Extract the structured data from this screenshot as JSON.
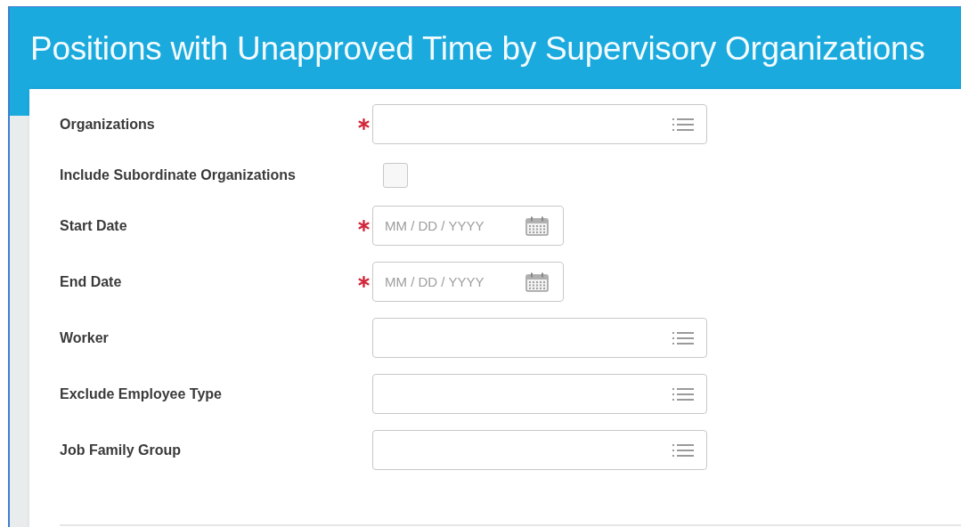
{
  "page": {
    "title": "Positions with Unapproved Time by Supervisory Organizations"
  },
  "fields": [
    {
      "label": "Organizations",
      "kind": "prompt",
      "required": true
    },
    {
      "label": "Include Subordinate Organizations",
      "kind": "checkbox",
      "required": false,
      "checked": false
    },
    {
      "label": "Start Date",
      "kind": "date",
      "required": true,
      "placeholder": "MM / DD / YYYY"
    },
    {
      "label": "End Date",
      "kind": "date",
      "required": true,
      "placeholder": "MM / DD / YYYY"
    },
    {
      "label": "Worker",
      "kind": "prompt",
      "required": false
    },
    {
      "label": "Exclude Employee Type",
      "kind": "prompt",
      "required": false
    },
    {
      "label": "Job Family Group",
      "kind": "prompt",
      "required": false
    }
  ]
}
